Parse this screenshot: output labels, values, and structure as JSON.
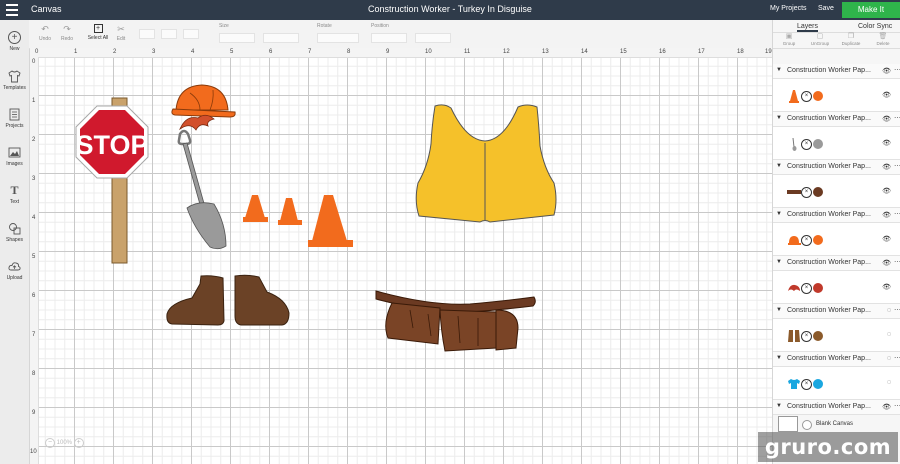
{
  "topbar": {
    "brand": "Canvas",
    "title": "Construction Worker - Turkey In Disguise",
    "my_projects": "My Projects",
    "save": "Save",
    "make_it": "Make It"
  },
  "toolbar": {
    "undo": "Undo",
    "redo": "Redo",
    "select_all": "Select All",
    "edit": "Edit",
    "size": "Size",
    "rotate": "Rotate",
    "position": "Position"
  },
  "leftnav": [
    {
      "label": "New",
      "icon": "plus-circle-icon"
    },
    {
      "label": "Templates",
      "icon": "shirt-icon"
    },
    {
      "label": "Projects",
      "icon": "projects-icon"
    },
    {
      "label": "Images",
      "icon": "image-icon"
    },
    {
      "label": "Text",
      "icon": "text-icon"
    },
    {
      "label": "Shapes",
      "icon": "shapes-icon"
    },
    {
      "label": "Upload",
      "icon": "upload-icon"
    }
  ],
  "ruler": {
    "x": [
      "0",
      "1",
      "2",
      "3",
      "4",
      "5",
      "6",
      "7",
      "8",
      "9",
      "10",
      "11",
      "12",
      "13",
      "14",
      "15",
      "16",
      "17",
      "18",
      "19"
    ],
    "y": [
      "0",
      "1",
      "2",
      "3",
      "4",
      "5",
      "6",
      "7",
      "8",
      "9",
      "10"
    ]
  },
  "layers_panel": {
    "tab_layers": "Layers",
    "tab_color_sync": "Color Sync",
    "actions": [
      "Group",
      "UnGroup",
      "Duplicate",
      "Delete"
    ],
    "layers": [
      {
        "name": "Construction Worker Pap...",
        "color": "#f26b1d",
        "thumb": "cone"
      },
      {
        "name": "Construction Worker Pap...",
        "color": "#9a9a9a",
        "thumb": "shovel"
      },
      {
        "name": "Construction Worker Pap...",
        "color": "#6b3a22",
        "thumb": "belt"
      },
      {
        "name": "Construction Worker Pap...",
        "color": "#f26b1d",
        "thumb": "hat"
      },
      {
        "name": "Construction Worker Pap...",
        "color": "#c0392b",
        "thumb": "hair"
      },
      {
        "name": "Construction Worker Pap...",
        "color": "#8b5a2b",
        "thumb": "boots"
      },
      {
        "name": "Construction Worker Pap...",
        "color": "#1aa7e0",
        "thumb": "tshirt"
      },
      {
        "name": "Construction Worker Pap...",
        "color": "#ffffff",
        "thumb": "none"
      }
    ],
    "blank_canvas": "Blank Canvas"
  },
  "canvas": {
    "stop_text": "STOP",
    "zoom": "100%"
  },
  "watermark": "gruro.com",
  "colors": {
    "topbar": "#2f3b4a",
    "make_it": "#2fb44b",
    "stop_red": "#d0192d",
    "vest_yellow": "#f5c12a",
    "cone_orange": "#f26b1d",
    "brown": "#6b4226"
  }
}
